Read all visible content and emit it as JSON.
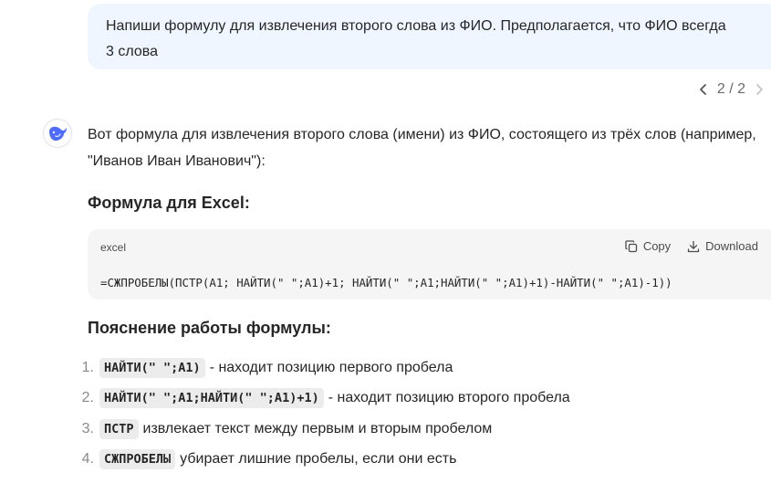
{
  "user_message": {
    "text": "Напиши формулу для извлечения второго слова из ФИО. Предполагается, что ФИО всегда 3 слова"
  },
  "pager": {
    "label": "2 / 2"
  },
  "assistant": {
    "intro": "Вот формула для извлечения второго слова (имени) из ФИО, состоящего из трёх слов (например, \"Иванов Иван Иванович\"):",
    "formula_heading": "Формула для Excel:",
    "code": {
      "lang": "excel",
      "copy_label": "Copy",
      "download_label": "Download",
      "text": "=СЖПРОБЕЛЫ(ПСТР(A1; НАЙТИ(\" \";A1)+1; НАЙТИ(\" \";A1;НАЙТИ(\" \";A1)+1)-НАЙТИ(\" \";A1)-1))"
    },
    "explain_heading": "Пояснение работы формулы:",
    "explain_items": [
      {
        "num": "1.",
        "code": "НАЙТИ(\" \";A1)",
        "text": "- находит позицию первого пробела"
      },
      {
        "num": "2.",
        "code": "НАЙТИ(\" \";A1;НАЙТИ(\" \";A1)+1)",
        "text": "- находит позицию второго пробела"
      },
      {
        "num": "3.",
        "code": "ПСТР",
        "text": "извлекает текст между первым и вторым пробелом"
      },
      {
        "num": "4.",
        "code": "СЖПРОБЕЛЫ",
        "text": "убирает лишние пробелы, если они есть"
      }
    ]
  },
  "colors": {
    "bubble": "#eff6ff",
    "code_bg": "#f5f5f5",
    "logo": "#4d6bfe"
  }
}
